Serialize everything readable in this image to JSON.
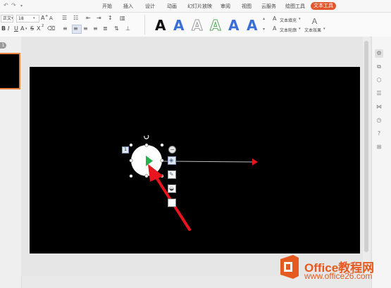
{
  "quick_access": {
    "undo_icon": "undo-icon",
    "redo_icon": "redo-icon",
    "more_icon": "dropdown-icon"
  },
  "menu": {
    "tabs": [
      {
        "label": "开始"
      },
      {
        "label": "插入"
      },
      {
        "label": "设计"
      },
      {
        "label": "动画"
      },
      {
        "label": "幻灯片放映"
      },
      {
        "label": "审阅"
      },
      {
        "label": "视图"
      },
      {
        "label": "云服务"
      },
      {
        "label": "绘图工具"
      },
      {
        "label": "文本工具"
      }
    ],
    "active_tab": "文本工具",
    "active_color": "#e2572e"
  },
  "toolbar": {
    "font_name": "正文",
    "font_size": "18",
    "grow_label": "A",
    "shrink_label": "A",
    "bold": "B",
    "italic": "I",
    "underline": "U",
    "strike": "S",
    "superscript": "X",
    "text_effect_letter": "A",
    "styles": [
      {
        "letter": "A",
        "fill": "#111111",
        "stroke": "none"
      },
      {
        "letter": "A",
        "fill": "#3b6fd6",
        "stroke": "none"
      },
      {
        "letter": "A",
        "fill": "#ffffff",
        "stroke": "#9a9a9a"
      },
      {
        "letter": "A",
        "fill": "#ffffff",
        "stroke": "#5aa55a"
      },
      {
        "letter": "A",
        "fill": "#3b6fd6",
        "stroke": "none"
      },
      {
        "letter": "A",
        "fill": "#3b6fd6",
        "stroke": "none"
      }
    ],
    "text_fill": "文本填充",
    "text_outline": "文本轮廓",
    "text_effect": "文本效果"
  },
  "slide_panel": {
    "slide_number": "1"
  },
  "shape": {
    "anim_badge": "1"
  },
  "watermark": {
    "title": "Office教程网",
    "url": "www.office26.com"
  },
  "colors": {
    "arrow": "#e8141e",
    "play": "#22b14c"
  }
}
